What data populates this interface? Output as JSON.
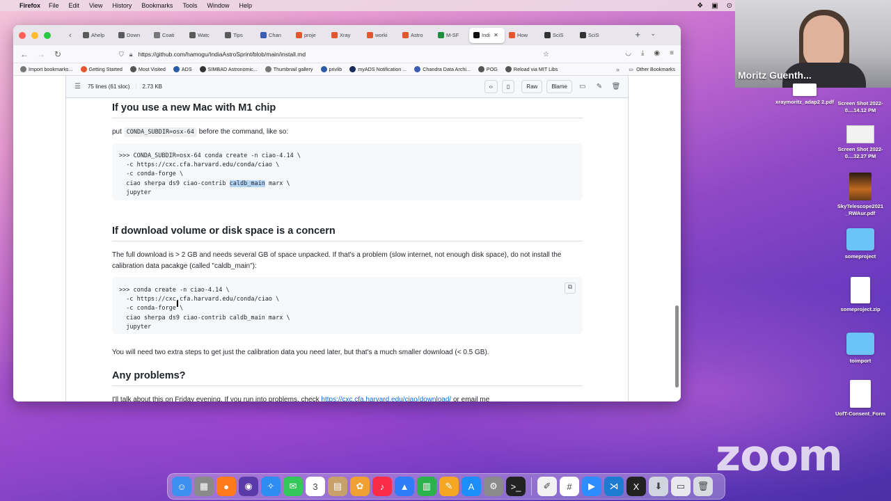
{
  "menubar": {
    "app": "Firefox",
    "items": [
      "File",
      "Edit",
      "View",
      "History",
      "Bookmarks",
      "Tools",
      "Window",
      "Help"
    ]
  },
  "tabs": [
    {
      "label": "Ahelp",
      "color": "#5a5a5a"
    },
    {
      "label": "Down",
      "color": "#5a5a5a"
    },
    {
      "label": "Coati",
      "color": "#777777"
    },
    {
      "label": "Watc",
      "color": "#5a5a5a"
    },
    {
      "label": "Tips",
      "color": "#5a5a5a"
    },
    {
      "label": "Chan",
      "color": "#3b5bb5"
    },
    {
      "label": "proje",
      "color": "#e4572e"
    },
    {
      "label": "Xray",
      "color": "#e4572e"
    },
    {
      "label": "worki",
      "color": "#e4572e"
    },
    {
      "label": "Astro",
      "color": "#e4572e"
    },
    {
      "label": "M-SF",
      "color": "#1e8e3e"
    },
    {
      "label": "Indi",
      "color": "#111111",
      "active": true
    },
    {
      "label": "How",
      "color": "#e4572e"
    },
    {
      "label": "SciS",
      "color": "#333333"
    },
    {
      "label": "SciS",
      "color": "#333333"
    }
  ],
  "url": "https://github.com/hamogu/IndiaAstroSprint/blob/main/install.md",
  "bookmarks": [
    {
      "label": "Import bookmarks...",
      "color": "#777777"
    },
    {
      "label": "Getting Started",
      "color": "#e4572e"
    },
    {
      "label": "Most Visited",
      "color": "#555555"
    },
    {
      "label": "ADS",
      "color": "#2b5ca8"
    },
    {
      "label": "SIMBAD Astronomic...",
      "color": "#333333"
    },
    {
      "label": "Thumbnail gallery",
      "color": "#777777"
    },
    {
      "label": "privlib",
      "color": "#2b5ca8"
    },
    {
      "label": "myADS Notification ...",
      "color": "#1a2a5a"
    },
    {
      "label": "Chandra Data Archi...",
      "color": "#3b5bb5"
    },
    {
      "label": "POG",
      "color": "#555555"
    },
    {
      "label": "Reload via MIT Libs",
      "color": "#555555"
    }
  ],
  "other_bookmarks": "Other Bookmarks",
  "file_header": {
    "lines": "75 lines (61 sloc)",
    "size": "2.73 KB",
    "raw": "Raw",
    "blame": "Blame"
  },
  "content": {
    "h_m1": "If you use a new Mac with M1 chip",
    "p_m1_pre": "put",
    "p_m1_code": "CONDA_SUBDIR=osx-64",
    "p_m1_post": "before the command, like so:",
    "code1": [
      ">>> CONDA_SUBDIR=osx-64 conda create -n ciao-4.14 \\",
      "  -c https://cxc.cfa.harvard.edu/conda/ciao \\",
      "  -c conda-forge \\"
    ],
    "code1_l4_pre": "  ciao sherpa ds9 ciao-contrib ",
    "code1_l4_hl": "caldb_main",
    "code1_l4_post": " marx \\",
    "code1_l5": "  jupyter",
    "h_dl": "If download volume or disk space is a concern",
    "p_dl": "The full download is > 2 GB and needs several GB of space unpacked. If that's a problem (slow internet, not enough disk space), do not install the calibration data pacakge (called \"caldb_main\"):",
    "code2": [
      ">>> conda create -n ciao-4.14 \\",
      "  -c https://cxc.cfa.harvard.edu/conda/ciao \\",
      "  -c conda-forge \\",
      "  ciao sherpa ds9 ciao-contrib caldb_main marx \\",
      "  jupyter"
    ],
    "p_extra": "You will need two extra steps to get just the calibration data you need later, but that's a much smaller download (< 0.5 GB).",
    "h_problems": "Any problems?",
    "p_problems_pre": "I'll talk about this on Friday evening. If you run into problems, check ",
    "p_problems_link": "https://cxc.cfa.harvard.edu/ciao/download/",
    "p_problems_post": " or email me"
  },
  "video": {
    "name": "Moritz Guenth..."
  },
  "desktop": [
    {
      "label": "xraymoritz_adap2 2.pdf",
      "kind": "file"
    },
    {
      "label": "Screen Shot 2022-0....14.12 PM",
      "kind": "shot"
    },
    {
      "label": "Screen Shot 2022-0....32.27 PM",
      "kind": "shot"
    },
    {
      "label": "SkyTelescope2021 _RWAur.pdf",
      "kind": "img"
    },
    {
      "label": "someproject",
      "kind": "folder"
    },
    {
      "label": "someproject.zip",
      "kind": "file"
    },
    {
      "label": "toimport",
      "kind": "folder"
    },
    {
      "label": "UofT-Consent_Form",
      "kind": "file"
    }
  ],
  "zoom_logo": "zoom",
  "dock": [
    {
      "name": "finder",
      "color": "#3d8ff0",
      "glyph": "☺"
    },
    {
      "name": "launchpad",
      "color": "#8a8a8a",
      "glyph": "▦"
    },
    {
      "name": "firefox",
      "color": "#ff7a1a",
      "glyph": "●"
    },
    {
      "name": "github-desktop",
      "color": "#5a3aa8",
      "glyph": "◉"
    },
    {
      "name": "safari",
      "color": "#2e8df0",
      "glyph": "✧"
    },
    {
      "name": "messages",
      "color": "#34c759",
      "glyph": "✉"
    },
    {
      "name": "calendar",
      "color": "#ffffff",
      "glyph": "3"
    },
    {
      "name": "notes",
      "color": "#c8a06a",
      "glyph": "▤"
    },
    {
      "name": "photos",
      "color": "#f0a030",
      "glyph": "✿"
    },
    {
      "name": "music",
      "color": "#fa2d48",
      "glyph": "♪"
    },
    {
      "name": "keynote",
      "color": "#2f7df6",
      "glyph": "▲"
    },
    {
      "name": "numbers",
      "color": "#2bb24c",
      "glyph": "▥"
    },
    {
      "name": "pages",
      "color": "#f5a623",
      "glyph": "✎"
    },
    {
      "name": "app-store",
      "color": "#1c8ef9",
      "glyph": "A"
    },
    {
      "name": "system-preferences",
      "color": "#8a8a8a",
      "glyph": "⚙"
    },
    {
      "name": "terminal",
      "color": "#222222",
      "glyph": ">_"
    },
    {
      "name": "textedit",
      "color": "#f2f2f2",
      "glyph": "✐"
    },
    {
      "name": "slack",
      "color": "#ffffff",
      "glyph": "#"
    },
    {
      "name": "zoom",
      "color": "#2d8cff",
      "glyph": "▶"
    },
    {
      "name": "vscode",
      "color": "#1f7bd1",
      "glyph": "⋊"
    },
    {
      "name": "x11",
      "color": "#222222",
      "glyph": "X"
    },
    {
      "name": "downloads",
      "color": "#cfd6e0",
      "glyph": "⬇"
    },
    {
      "name": "documents",
      "color": "#e8e8ee",
      "glyph": "▭"
    },
    {
      "name": "trash",
      "color": "#d8dbe0",
      "glyph": "🗑"
    }
  ]
}
